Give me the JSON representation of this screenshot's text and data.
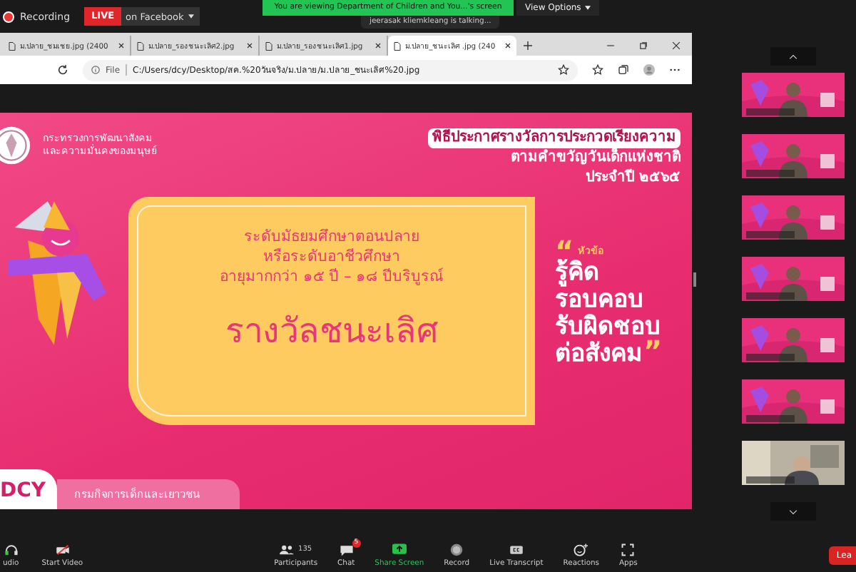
{
  "zoom_bar": {
    "recording": "Recording",
    "live_badge": "LIVE",
    "live_target": "on Facebook",
    "share_banner": "You are viewing Department of Children and You...'s screen",
    "view_options": "View Options",
    "talking": "jeerasak kliemkleang is talking..."
  },
  "browser": {
    "tabs": [
      {
        "title": "ม.ปลาย_ชมเชย.jpg (2400",
        "selected": false
      },
      {
        "title": "ม.ปลาย_รองชนะเลิศ2.jpg",
        "selected": false
      },
      {
        "title": "ม.ปลาย_รองชนะเลิศ1.jpg",
        "selected": false
      },
      {
        "title": "ม.ปลาย_ชนะเลิศ .jpg (240",
        "selected": true
      }
    ],
    "scheme": "File",
    "url": "C:/Users/dcy/Desktop/สค.%20วันจริง/ม.ปลาย/ม.ปลาย_ชนะเลิศ%20.jpg"
  },
  "slide": {
    "org_lines": [
      "กระทรวงการพัฒนาสังคม",
      "และความมั่นคงของมนุษย์"
    ],
    "title": "พิธีประกาศรางวัลการประกวดเรียงความ",
    "subtitle_lines": [
      "ตามคำขวัญวันเด็กแห่งชาติ",
      "ประจำปี ๒๕๖๕"
    ],
    "level_lines": [
      "ระดับมัธยมศึกษาตอนปลาย",
      "หรือระดับอาชีวศึกษา",
      "อายุมากกว่า ๑๕ ปี – ๑๘ ปีบริบูรณ์"
    ],
    "award": "รางวัลชนะเลิศ",
    "topic_label": "หัวข้อ",
    "open_quote": "“",
    "close_quote": "”",
    "motto_lines": [
      "รู้คิด",
      "รอบคอบ",
      "รับผิดชอบ",
      "ต่อสังคม"
    ],
    "logo_text": "DCY",
    "department": "กรมกิจการเด็กและเยาวชน"
  },
  "video_tiles": [
    {
      "kind": "slide"
    },
    {
      "kind": "slide"
    },
    {
      "kind": "slide"
    },
    {
      "kind": "slide"
    },
    {
      "kind": "slide"
    },
    {
      "kind": "slide"
    },
    {
      "kind": "room"
    }
  ],
  "toolbar": {
    "items": [
      {
        "kind": "audio",
        "label": "udio"
      },
      {
        "kind": "video",
        "label": "Start Video"
      },
      {
        "kind": "participants",
        "label": "Participants",
        "count": "135"
      },
      {
        "kind": "chat",
        "label": "Chat",
        "badge": "5"
      },
      {
        "kind": "share",
        "label": "Share Screen"
      },
      {
        "kind": "record",
        "label": "Record"
      },
      {
        "kind": "transcript",
        "label": "Live Transcript"
      },
      {
        "kind": "reactions",
        "label": "Reactions"
      },
      {
        "kind": "apps",
        "label": "Apps"
      }
    ],
    "leave": "Lea"
  }
}
